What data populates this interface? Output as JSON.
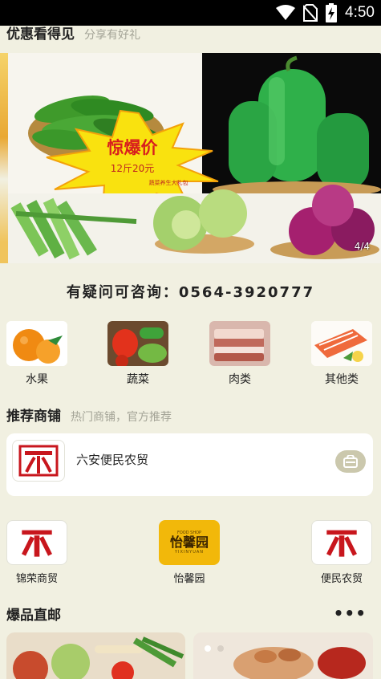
{
  "status_bar": {
    "time": "4:50"
  },
  "promo": {
    "title": "优惠看得见",
    "subtitle": "分享有好礼"
  },
  "banner": {
    "headline": "惊爆价",
    "price_text": "12斤20元",
    "tag": "蔬菜养生大礼包",
    "pager": "4/4"
  },
  "consult": {
    "text": "有疑问可咨询：0564-3920777"
  },
  "categories": [
    {
      "label": "水果",
      "icon": "orange-icon"
    },
    {
      "label": "蔬菜",
      "icon": "vegetable-icon"
    },
    {
      "label": "肉类",
      "icon": "meat-icon"
    },
    {
      "label": "其他类",
      "icon": "seafood-icon"
    }
  ],
  "recommend": {
    "title": "推荐商铺",
    "subtitle": "热门商铺，官方推荐"
  },
  "featured_shop": {
    "name": "六安便民农贸",
    "button_icon": "shop-icon"
  },
  "brands": [
    {
      "label": "锦荣商贸"
    },
    {
      "label": "怡馨园",
      "logo_text": "怡馨园",
      "logo_subtext": "YIXINYUAN",
      "logo_top": "FOOD SHOP"
    },
    {
      "label": "便民农贸"
    }
  ],
  "hot": {
    "title": "爆品直邮",
    "more": "•••"
  },
  "colors": {
    "brand_red": "#c8161d",
    "bg": "#f1f0e1",
    "gold": "#f2b80a"
  }
}
